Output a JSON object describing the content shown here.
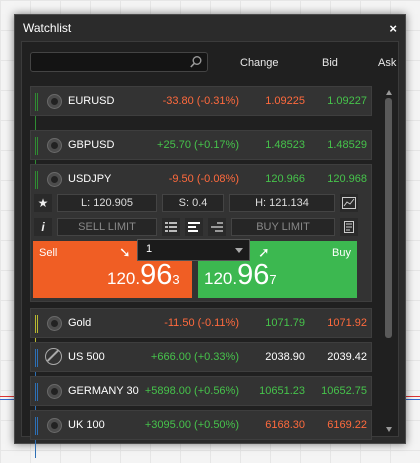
{
  "window": {
    "title": "Watchlist",
    "close_label": "×"
  },
  "toolbar": {
    "search_value": "",
    "headers": {
      "change": "Change",
      "bid": "Bid",
      "ask": "Ask"
    }
  },
  "rows": [
    {
      "symbol": "EURUSD",
      "change": "-33.80 (-0.31%)",
      "bid": "1.09225",
      "ask": "1.09227",
      "stripe": "#2f8c32"
    },
    {
      "symbol": "GBPUSD",
      "change": "+25.70 (+0.17%)",
      "bid": "1.48523",
      "ask": "1.48529",
      "stripe": "#2f8c32"
    },
    {
      "symbol": "USDJPY",
      "change": "-9.50 (-0.08%)",
      "bid": "120.966",
      "ask": "120.968",
      "stripe": "#2f8c32"
    },
    {
      "symbol": "Gold",
      "change": "-11.50 (-0.11%)",
      "bid": "1071.79",
      "ask": "1071.92",
      "stripe": "#b8b830"
    },
    {
      "symbol": "US 500",
      "change": "+666.00 (+0.33%)",
      "bid": "2038.90",
      "ask": "2039.42",
      "stripe": "#2d6fb5"
    },
    {
      "symbol": "GERMANY 30",
      "change": "+5898.00 (+0.56%)",
      "bid": "10651.23",
      "ask": "10652.75",
      "stripe": "#2d6fb5"
    },
    {
      "symbol": "UK 100",
      "change": "+3095.00 (+0.50%)",
      "bid": "6168.30",
      "ask": "6169.22",
      "stripe": "#2d6fb5"
    }
  ],
  "expanded": {
    "low": "L: 120.905",
    "spread": "S: 0.4",
    "high": "H: 121.134",
    "sell_limit": "SELL LIMIT",
    "buy_limit": "BUY LIMIT",
    "info_label": "i",
    "quantity": "1",
    "sell": {
      "label": "Sell",
      "arrow": "➘",
      "small": "120.",
      "big": "96",
      "pip": "3"
    },
    "buy": {
      "label": "Buy",
      "arrow": "➚",
      "small": "120.",
      "big": "96",
      "pip": "7"
    }
  },
  "colors": {
    "sell": "#f05e24",
    "buy": "#3cb850",
    "negative": "#ff6a3d",
    "positive": "#46c34b"
  }
}
